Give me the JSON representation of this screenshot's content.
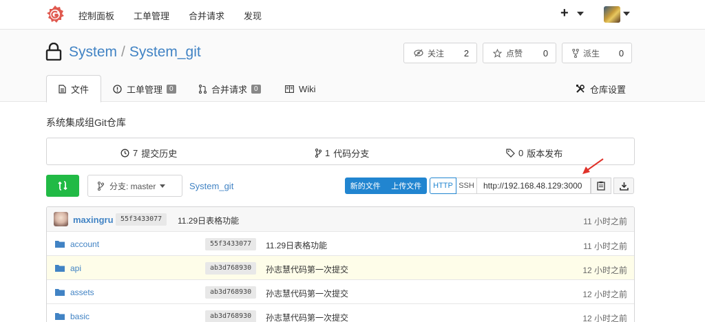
{
  "nav": {
    "items": [
      "控制面板",
      "工单管理",
      "合并请求",
      "发现"
    ],
    "plus": "+"
  },
  "repo": {
    "owner": "System",
    "separator": "/",
    "name": "System_git",
    "watch": {
      "label": "关注",
      "count": "2"
    },
    "star": {
      "label": "点赞",
      "count": "0"
    },
    "fork": {
      "label": "派生",
      "count": "0"
    }
  },
  "tabs": {
    "files": "文件",
    "issues": {
      "label": "工单管理",
      "count": "0"
    },
    "pulls": {
      "label": "合并请求",
      "count": "0"
    },
    "wiki": "Wiki",
    "settings": "仓库设置"
  },
  "description": "系统集成组Git仓库",
  "stats": {
    "commits": {
      "count": "7",
      "label": "提交历史"
    },
    "branches": {
      "count": "1",
      "label": "代码分支"
    },
    "releases": {
      "count": "0",
      "label": "版本发布"
    }
  },
  "toolbar": {
    "branch_label": "分支: master",
    "breadcrumb": "System_git",
    "new_file": "新的文件",
    "upload_file": "上传文件",
    "http": "HTTP",
    "ssh": "SSH",
    "clone_url": "http://192.168.48.129:3000"
  },
  "latest_commit": {
    "author": "maxingru",
    "sha": "55f3433077",
    "message": "11.29日表格功能",
    "time": "11 小时之前"
  },
  "files": [
    {
      "name": "account",
      "sha": "55f3433077",
      "message": "11.29日表格功能",
      "time": "11 小时之前"
    },
    {
      "name": "api",
      "sha": "ab3d768930",
      "message": "孙志慧代码第一次提交",
      "time": "12 小时之前"
    },
    {
      "name": "assets",
      "sha": "ab3d768930",
      "message": "孙志慧代码第一次提交",
      "time": "12 小时之前"
    },
    {
      "name": "basic",
      "sha": "ab3d768930",
      "message": "孙志慧代码第一次提交",
      "time": "12 小时之前"
    }
  ],
  "colors": {
    "link": "#4183c4",
    "green": "#21ba45",
    "blue": "#2185d0",
    "logo": "#e05a50",
    "arrow": "#e0322a",
    "highlight_row": "#fefde9"
  }
}
